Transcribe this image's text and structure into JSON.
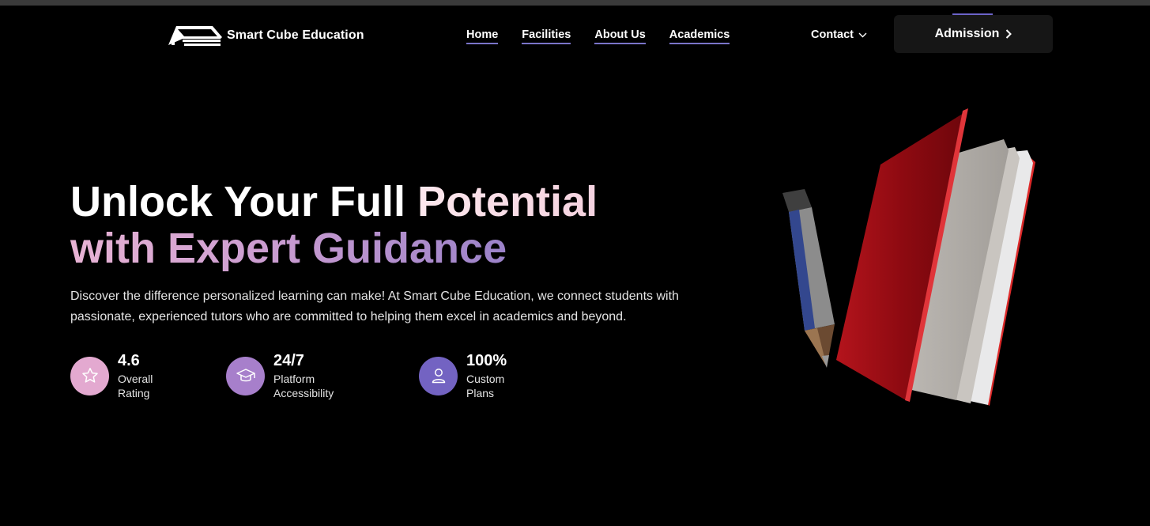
{
  "brand": {
    "name": "Smart Cube Education"
  },
  "nav": {
    "items": [
      {
        "label": "Home"
      },
      {
        "label": "Facilities"
      },
      {
        "label": "About Us"
      },
      {
        "label": "Academics"
      }
    ],
    "contact_label": "Contact",
    "admission_label": "Admission"
  },
  "hero": {
    "title_plain": "Unlock Your Full ",
    "title_highlight_1": "Potential",
    "title_highlight_2": "with Expert Guidance",
    "description": "Discover the difference personalized learning can make! At Smart Cube Education, we connect students with passionate, experienced tutors who are committed to helping them excel in academics and beyond."
  },
  "stats": [
    {
      "value": "4.6",
      "label": "Overall Rating",
      "icon": "star-icon",
      "color": "#e3a9d0"
    },
    {
      "value": "24/7",
      "label": "Platform Accessibility",
      "icon": "graduation-cap-icon",
      "color": "#a77fcb"
    },
    {
      "value": "100%",
      "label": "Custom Plans",
      "icon": "user-icon",
      "color": "#7363c2"
    }
  ],
  "colors": {
    "background": "#000000",
    "nav_underline": "#7a74c9",
    "button_bg": "#161616",
    "book_red": "#9b0b12"
  }
}
